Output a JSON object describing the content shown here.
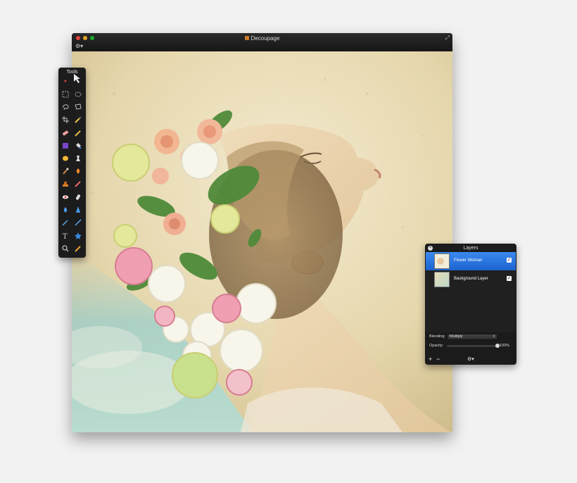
{
  "window": {
    "title": "Decoupage",
    "doc_icon": "document-icon",
    "gear_menu": "⚙▾",
    "fullscreen": "⤢"
  },
  "tools_panel": {
    "title": "Tools",
    "tools": [
      "move-tool-icon",
      "arrow-tool-icon",
      "rect-select-icon",
      "ellipse-select-icon",
      "lasso-icon",
      "polygon-lasso-icon",
      "crop-icon",
      "eyedropper-icon",
      "eraser-icon",
      "pencil-icon",
      "gradient-icon",
      "paint-bucket-icon",
      "fill-ellipse-icon",
      "clone-stamp-icon",
      "brush-icon",
      "burn-icon",
      "stamp-icon",
      "smudge-icon",
      "red-eye-icon",
      "smudge-finger-icon",
      "drop-icon",
      "sharpen-icon",
      "pen-icon",
      "line-icon",
      "text-icon",
      "shape-icon",
      "zoom-icon",
      "color-picker-icon"
    ]
  },
  "layers_panel": {
    "title": "Layers",
    "layers": [
      {
        "name": "Flower Woman",
        "visible": true,
        "selected": true
      },
      {
        "name": "Background Layer",
        "visible": true,
        "selected": false
      }
    ],
    "blending_label": "Blending:",
    "blending_value": "Multiply",
    "opacity_label": "Opacity:",
    "opacity_value": "100%",
    "opacity": 1.0,
    "footer": {
      "add": "+",
      "remove": "−",
      "settings": "⚙▾"
    }
  },
  "colors": {
    "selection": "#2a74e0",
    "panel_bg": "#1b1b1b",
    "close": "#e0443e",
    "minimize": "#dea123",
    "zoom": "#1aab29"
  }
}
